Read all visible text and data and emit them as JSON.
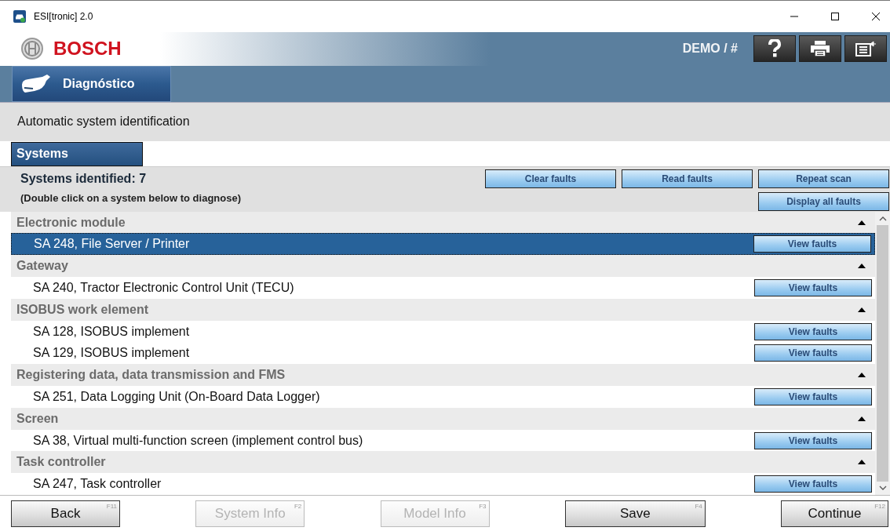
{
  "window": {
    "title": "ESI[tronic] 2.0"
  },
  "header": {
    "brand": "BOSCH",
    "user": "DEMO / #"
  },
  "module_tab": {
    "label": "Diagnóstico"
  },
  "subtitle": "Automatic system identification",
  "section_tab": {
    "label": "Systems"
  },
  "summary": {
    "count_text": "Systems identified: 7",
    "hint": "(Double click on a system below to diagnose)"
  },
  "actions": [
    {
      "label": "Clear faults"
    },
    {
      "label": "Read faults"
    },
    {
      "label": "Repeat scan"
    },
    {
      "label": "Display all faults"
    }
  ],
  "groups": [
    {
      "name": "Electronic module",
      "expanded": true,
      "items": [
        {
          "label": "SA 248, File Server / Printer",
          "selected": true,
          "button": "View faults"
        }
      ]
    },
    {
      "name": "Gateway",
      "expanded": true,
      "items": [
        {
          "label": "SA 240, Tractor Electronic Control Unit (TECU)",
          "selected": false,
          "button": "View faults"
        }
      ]
    },
    {
      "name": "ISOBUS work element",
      "expanded": true,
      "items": [
        {
          "label": "SA 128, ISOBUS implement",
          "selected": false,
          "button": "View faults"
        },
        {
          "label": "SA 129, ISOBUS implement",
          "selected": false,
          "button": "View faults"
        }
      ]
    },
    {
      "name": "Registering data, data transmission and FMS",
      "expanded": true,
      "items": [
        {
          "label": "SA 251, Data Logging Unit (On-Board Data Logger)",
          "selected": false,
          "button": "View faults"
        }
      ]
    },
    {
      "name": "Screen",
      "expanded": true,
      "items": [
        {
          "label": "SA 38, Virtual multi-function screen (implement control bus)",
          "selected": false,
          "button": "View faults"
        }
      ]
    },
    {
      "name": "Task controller",
      "expanded": true,
      "items": [
        {
          "label": "SA 247, Task controller",
          "selected": false,
          "button": "View faults"
        }
      ]
    }
  ],
  "footer": [
    {
      "label": "Back",
      "key": "F11",
      "disabled": false
    },
    {
      "label": "System Info",
      "key": "F2",
      "disabled": true
    },
    {
      "label": "Model Info",
      "key": "F3",
      "disabled": true
    },
    {
      "label": "Save",
      "key": "F4",
      "disabled": false
    },
    {
      "label": "Continue",
      "key": "F12",
      "disabled": false
    }
  ]
}
